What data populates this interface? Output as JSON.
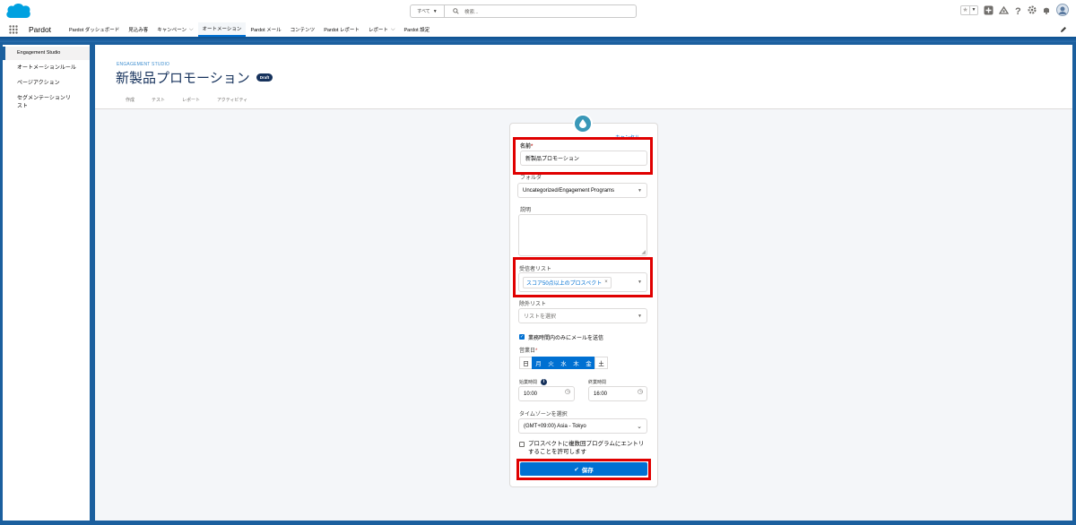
{
  "colors": {
    "brand_blue": "#0070d2",
    "frame_blue": "#1b5f9e",
    "highlight_red": "#e00000",
    "title_navy": "#16325c"
  },
  "header": {
    "search_scope": "すべて",
    "search_placeholder": "検索..."
  },
  "nav": {
    "app_name": "Pardot",
    "items": [
      {
        "label": "Pardot ダッシュボード",
        "dropdown": false
      },
      {
        "label": "見込み客",
        "dropdown": false
      },
      {
        "label": "キャンペーン",
        "dropdown": true
      },
      {
        "label": "オートメーション",
        "dropdown": false,
        "active": true
      },
      {
        "label": "Pardot メール",
        "dropdown": false
      },
      {
        "label": "コンテンツ",
        "dropdown": false
      },
      {
        "label": "Pardot レポート",
        "dropdown": false
      },
      {
        "label": "レポート",
        "dropdown": true
      },
      {
        "label": "Pardot 設定",
        "dropdown": false
      }
    ]
  },
  "left_nav": {
    "items": [
      "Engagement Studio",
      "オートメーションルール",
      "ページアクション",
      "セグメンテーションリスト"
    ]
  },
  "page": {
    "breadcrumb": "ENGAGEMENT STUDIO",
    "title": "新製品プロモーション",
    "badge": "Draft",
    "tabs": [
      "作成",
      "テスト",
      "レポート",
      "アクティビティ"
    ]
  },
  "form": {
    "cancel_label": "キャンセル",
    "name_label": "名前",
    "name_value": "新製品プロモーション",
    "folder_label": "フォルダ",
    "folder_value": "Uncategorized/Engagement Programs",
    "description_label": "説明",
    "description_value": "",
    "recipient_label": "受信者リスト",
    "recipient_pill": "スコア50点以上のプロスペクト",
    "suppression_label": "除外リスト",
    "suppression_placeholder": "リストを選択",
    "business_hours_label": "業務時間内のみにメールを送信",
    "business_hours_checked": true,
    "business_days_label": "営業日",
    "days": [
      {
        "label": "日",
        "on": false
      },
      {
        "label": "月",
        "on": true
      },
      {
        "label": "火",
        "on": true
      },
      {
        "label": "水",
        "on": true
      },
      {
        "label": "木",
        "on": true
      },
      {
        "label": "金",
        "on": true
      },
      {
        "label": "土",
        "on": false
      }
    ],
    "start_time_label": "始業時間",
    "start_time_value": "10:00",
    "end_time_label": "終業時間",
    "end_time_value": "16:00",
    "timezone_label": "タイムゾーンを選択",
    "timezone_value": "(GMT+09:00) Asia - Tokyo",
    "multi_entry_label": "プロスペクトに複数回プログラムにエントリすることを許可します",
    "multi_entry_checked": false,
    "save_label": "保存"
  }
}
